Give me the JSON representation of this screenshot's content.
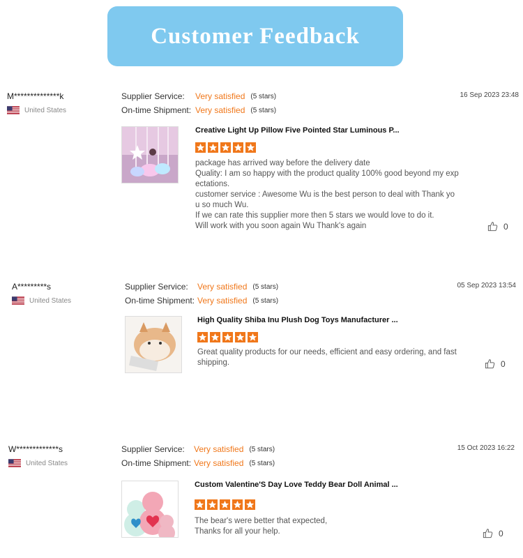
{
  "header": {
    "title": "Customer Feedback"
  },
  "labels": {
    "supplier_service": "Supplier Service:",
    "ontime_shipment": "On-time Shipment:"
  },
  "reviews": [
    {
      "reviewer": "M**************k",
      "country": "United States",
      "date": "16 Sep 2023 23:48",
      "supplier_service": "Very satisfied",
      "supplier_stars": "(5 stars)",
      "shipment": "Very satisfied",
      "shipment_stars": "(5 stars)",
      "product_title": "Creative Light Up Pillow Five Pointed Star Luminous P...",
      "product_rating": 5,
      "comment_lines": [
        "package has arrived way before the delivery date",
        "Quality: I am so happy with the product quality 100% good beyond my exp",
        "ectations.",
        "customer service : Awesome Wu is the best person to deal with Thank yo",
        "u so much Wu.",
        "If we can rate this supplier more then 5 stars we would love to do it.",
        "Will work with you soon again Wu Thank's again"
      ],
      "likes": "0"
    },
    {
      "reviewer": "A*********s",
      "country": "United States",
      "date": "05 Sep 2023 13:54",
      "supplier_service": "Very satisfied",
      "supplier_stars": "(5 stars)",
      "shipment": "Very satisfied",
      "shipment_stars": "(5 stars)",
      "product_title": "High Quality Shiba Inu Plush Dog Toys Manufacturer ...",
      "product_rating": 5,
      "comment_lines": [
        "Great quality products for our needs, efficient and easy ordering, and fast",
        "shipping."
      ],
      "likes": "0"
    },
    {
      "reviewer": "W*************s",
      "country": "United States",
      "date": "15 Oct 2023 16:22",
      "supplier_service": "Very satisfied",
      "supplier_stars": "(5 stars)",
      "shipment": "Very satisfied",
      "shipment_stars": "(5 stars)",
      "product_title": "Custom Valentine'S Day Love Teddy Bear Doll Animal ...",
      "product_rating": 5,
      "comment_lines": [
        "The bear's were better that expected,",
        "Thanks for all your help."
      ],
      "likes": "0"
    }
  ],
  "colors": {
    "banner": "#7fc9ef",
    "accent": "#f0771a",
    "star": "#f0771a"
  },
  "icons": {
    "flag": "us-flag-icon",
    "like": "thumbs-up-icon",
    "star": "star-icon"
  }
}
